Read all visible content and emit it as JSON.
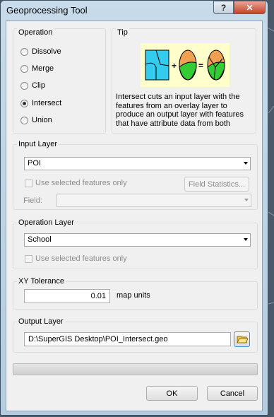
{
  "window": {
    "title": "Geoprocessing Tool",
    "help": "?",
    "close": "✕"
  },
  "operation": {
    "label": "Operation",
    "options": [
      "Dissolve",
      "Merge",
      "Clip",
      "Intersect",
      "Union"
    ],
    "selected": "Intersect"
  },
  "tip": {
    "label": "Tip",
    "text": "Intersect cuts an input layer with the features from an overlay layer to produce an output layer with features that have attribute data from both"
  },
  "input_layer": {
    "label": "Input Layer",
    "value": "POI",
    "use_selected": "Use selected features only",
    "field_stats": "Field Statistics...",
    "field_label": "Field:",
    "field_value": ""
  },
  "operation_layer": {
    "label": "Operation Layer",
    "value": "School",
    "use_selected": "Use selected features only"
  },
  "xy_tolerance": {
    "label": "XY Tolerance",
    "value": "0.01",
    "units": "map units"
  },
  "output_layer": {
    "label": "Output Layer",
    "path": "D:\\SuperGIS Desktop\\POI_Intersect.geo"
  },
  "progress": 0,
  "buttons": {
    "ok": "OK",
    "cancel": "Cancel"
  },
  "colors": {
    "accent_cyan": "#33ccee",
    "orange": "#f0a050",
    "green": "#33cc33",
    "tip_bg": "#ffffcc"
  }
}
